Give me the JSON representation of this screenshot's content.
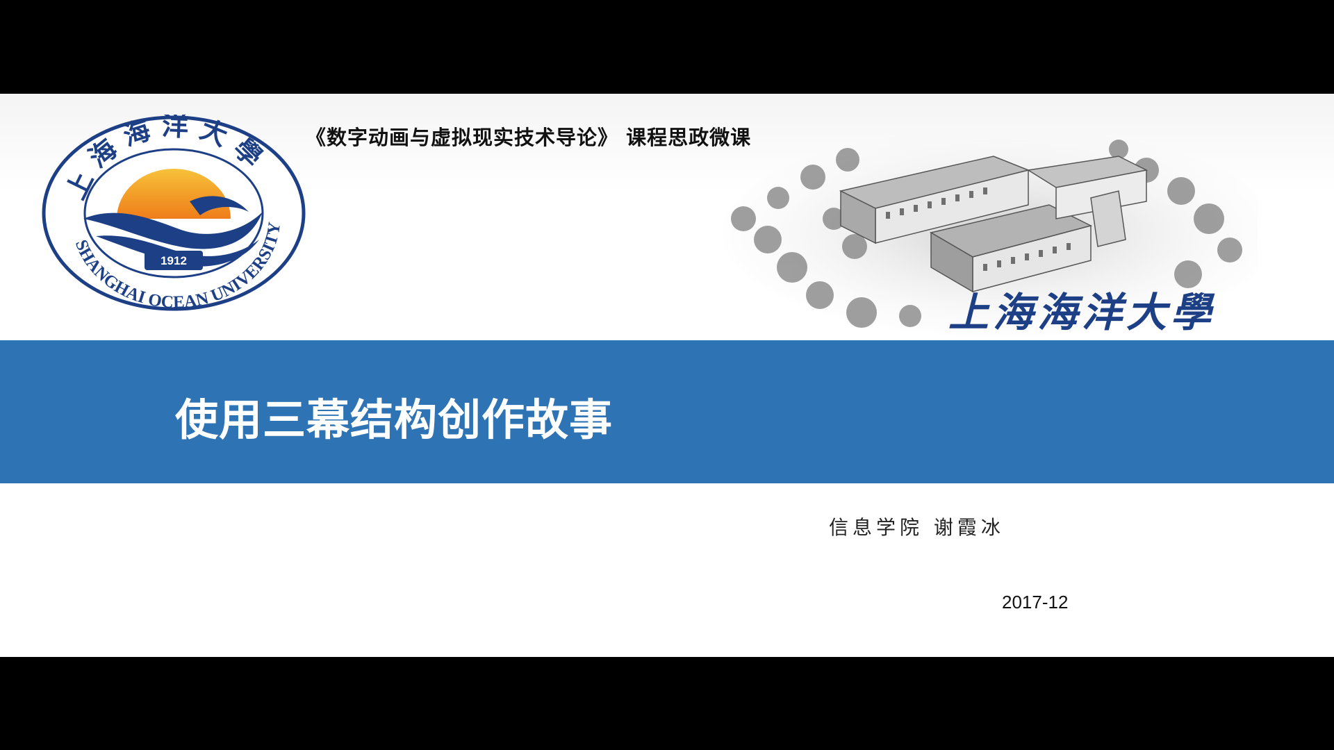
{
  "slide": {
    "course_title": "《数字动画与虚拟现实技术导论》 课程思政微课",
    "main_title": "使用三幕结构创作故事",
    "author": "信息学院 谢霞冰",
    "date": "2017-12"
  },
  "logo": {
    "icon": "university-seal-icon",
    "chinese_name": "上海海洋大學",
    "english_name": "SHANGHAI OCEAN UNIVERSITY",
    "year": "1912"
  },
  "campus": {
    "icon": "campus-illustration-icon",
    "name": "上海海洋大學"
  },
  "colors": {
    "band": "#2e74b5",
    "seal_blue": "#1c3f86",
    "sun_orange": "#f39a1e"
  }
}
